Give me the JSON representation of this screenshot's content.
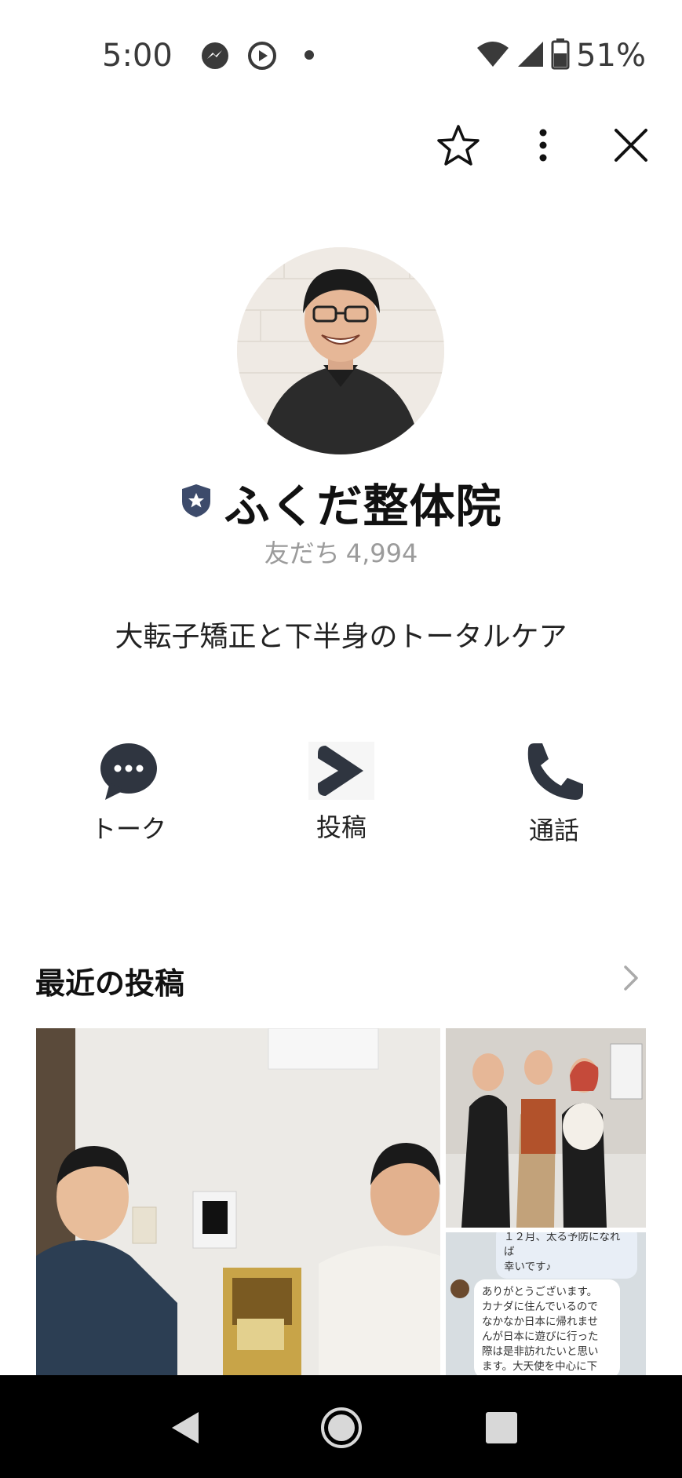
{
  "status_bar": {
    "time": "5:00",
    "icons": [
      "messenger-icon",
      "media-icon",
      "dot-icon"
    ],
    "battery": "51%"
  },
  "header": {
    "icons": [
      "star-icon",
      "more-icon",
      "close-icon"
    ]
  },
  "profile": {
    "name": "ふくだ整体院",
    "friends_label": "友だち",
    "friends_count": "4,994",
    "status_message": "大転子矯正と下半身のトータルケア"
  },
  "actions": [
    {
      "label": "トーク",
      "icon": "chat-icon"
    },
    {
      "label": "投稿",
      "icon": "post-icon"
    },
    {
      "label": "通話",
      "icon": "phone-icon"
    }
  ],
  "recent_posts": {
    "title": "最近の投稿",
    "chat_preview": {
      "line1": "１２月、太る予防になれば",
      "line2": "幸いです♪",
      "message": [
        "ありがとうございます。",
        "カナダに住んでいるので",
        "なかなか日本に帰れませ",
        "んが日本に遊びに行った",
        "際は是非訪れたいと思い",
        "ます。大天使を中心に下"
      ]
    }
  },
  "colors": {
    "badge": "#3d4b6b",
    "text": "#111111",
    "muted": "#9b9b9b",
    "nav_bg": "#000000"
  }
}
